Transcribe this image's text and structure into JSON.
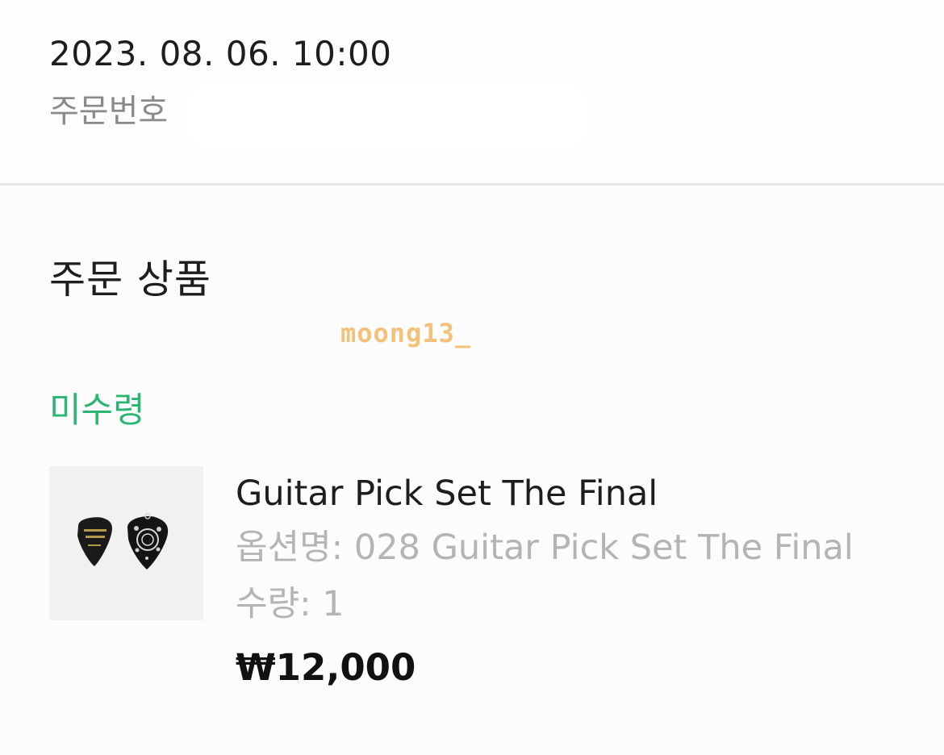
{
  "order": {
    "datetime": "2023. 08. 06. 10:00",
    "order_number_label": "주문번호"
  },
  "section": {
    "title": "주문 상품"
  },
  "watermark": "moong13_",
  "item": {
    "status": "미수령",
    "status_color": "#2bb673",
    "name": "Guitar Pick Set The Final",
    "option": "옵션명: 028 Guitar Pick Set The Final",
    "quantity": "수량: 1",
    "price": "₩12,000",
    "thumbnail_icon": "guitar-pick-set-image"
  }
}
